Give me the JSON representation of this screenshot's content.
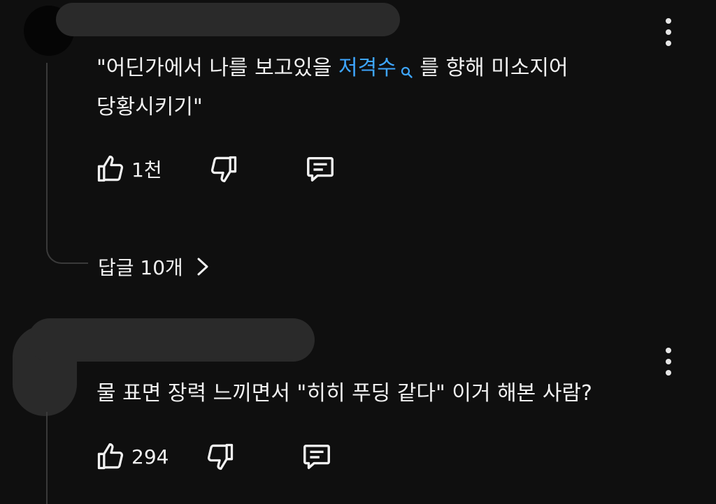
{
  "comments": [
    {
      "text_before": "\"어딘가에서 나를 보고있을 ",
      "link_text": "저격수",
      "text_after": " 를 향해 미소지어",
      "line2": "당황시키기\"",
      "like_count": "1천",
      "replies_label": "답글 10개"
    },
    {
      "text": "물 표면 장력 느끼면서 \"히히 푸딩 같다\" 이거 해본 사람?",
      "like_count": "294"
    }
  ],
  "icons": {
    "like": "thumb-up-icon",
    "dislike": "thumb-down-icon",
    "reply": "comment-icon",
    "more": "more-vert-icon",
    "link_search": "search-icon",
    "replies_chevron": "chevron-right-icon"
  },
  "colors": {
    "background": "#0f0f0f",
    "text": "#f1f1f1",
    "link": "#3ea6ff",
    "redaction": "#2a2a2a"
  }
}
